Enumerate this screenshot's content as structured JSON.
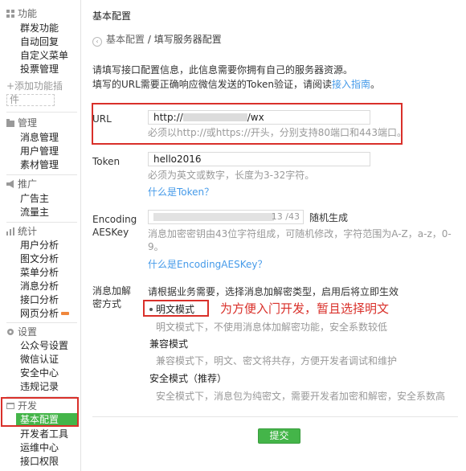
{
  "sidebar": {
    "sections": [
      {
        "name": "functions",
        "title": "功能",
        "icon": "grid-icon",
        "items": [
          "群发功能",
          "自动回复",
          "自定义菜单",
          "投票管理"
        ],
        "add_label": "添加功能插件",
        "add_label_line1": "+添加功能插",
        "add_label_line2": "件"
      },
      {
        "name": "management",
        "title": "管理",
        "icon": "folder-icon",
        "items": [
          "消息管理",
          "用户管理",
          "素材管理"
        ]
      },
      {
        "name": "promotion",
        "title": "推广",
        "icon": "megaphone-icon",
        "items": [
          "广告主",
          "流量主"
        ]
      },
      {
        "name": "statistics",
        "title": "统计",
        "icon": "chart-icon",
        "items": [
          "用户分析",
          "图文分析",
          "菜单分析",
          "消息分析",
          "接口分析",
          "网页分析"
        ]
      },
      {
        "name": "settings",
        "title": "设置",
        "icon": "gear-icon",
        "items": [
          "公众号设置",
          "微信认证",
          "安全中心",
          "违规记录"
        ]
      },
      {
        "name": "develop",
        "title": "开发",
        "icon": "code-icon",
        "items": [
          "基本配置",
          "开发者工具",
          "运维中心",
          "接口权限"
        ],
        "active": "基本配置"
      }
    ]
  },
  "main": {
    "page_title": "基本配置",
    "breadcrumb": {
      "back": "‹",
      "parent": "基本配置",
      "separator": " / ",
      "current": "填写服务器配置"
    },
    "intro_line1": "请填写接口配置信息，此信息需要你拥有自己的服务器资源。",
    "intro_line2_prefix": "填写的URL需要正确响应微信发送的Token验证，请阅读",
    "intro_link": "接入指南",
    "intro_line2_suffix": "。",
    "url": {
      "label": "URL",
      "value_prefix": "http://",
      "value_suffix": "/wx",
      "hint": "必须以http://或https://开头，分别支持80端口和443端口。"
    },
    "token": {
      "label": "Token",
      "value": "hello2016",
      "hint": "必须为英文或数字，长度为3-32字符。",
      "link": "什么是Token？"
    },
    "aeskey": {
      "label_line1": "Encoding",
      "label_line2": "AESKey",
      "count": "13 /43",
      "generate": "随机生成",
      "hint_line1": "消息加密密钥由43位字符组成，可随机修改，字符范围为A-Z，a-z，0-",
      "hint_line2": "9。",
      "link": "什么是EncodingAESKey？"
    },
    "encryption": {
      "label_line1": "消息加解",
      "label_line2": "密方式",
      "intro": "请根据业务需要，选择消息加解密类型，启用后将立即生效",
      "options": [
        {
          "label": "明文模式",
          "hint": "明文模式下，不使用消息体加解密功能，安全系数较低",
          "selected": true
        },
        {
          "label": "兼容模式",
          "hint": "兼容模式下，明文、密文将共存，方便开发者调试和维护",
          "selected": false
        },
        {
          "label": "安全模式（推荐）",
          "hint": "安全模式下，消息包为纯密文，需要开发者加密和解密，安全系数高",
          "selected": false
        }
      ],
      "annotation": "为方便入门开发，暂且选择明文"
    },
    "submit": "提交"
  },
  "colors": {
    "accent_green": "#44b549",
    "link_blue": "#459ae9",
    "annotation_red": "#d9302a"
  }
}
